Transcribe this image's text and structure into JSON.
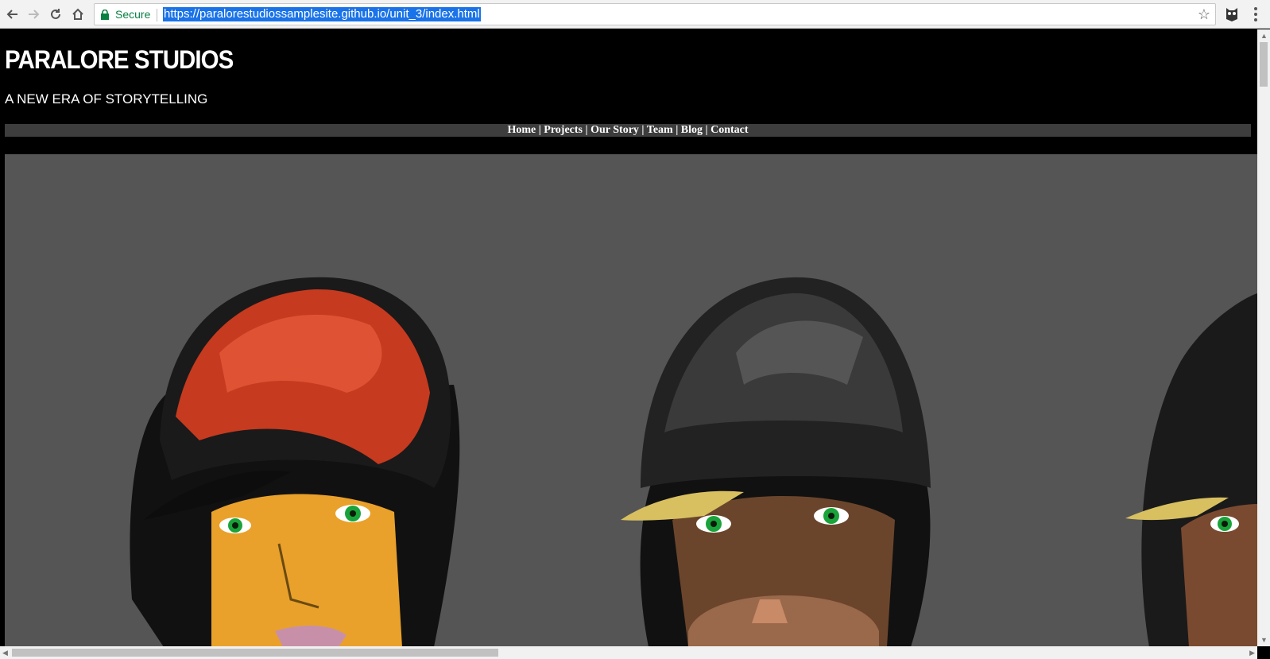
{
  "browser": {
    "secure_label": "Secure",
    "url": "https://paralorestudiossamplesite.github.io/unit_3/index.html"
  },
  "site": {
    "title": "PARALORE STUDIOS",
    "tagline": "A NEW ERA OF STORYTELLING",
    "nav": [
      {
        "label": "Home"
      },
      {
        "label": "Projects"
      },
      {
        "label": "Our Story"
      },
      {
        "label": "Team"
      },
      {
        "label": "Blog"
      },
      {
        "label": "Contact"
      }
    ],
    "nav_separator": " | "
  },
  "colors": {
    "page_bg": "#000000",
    "navbar_bg": "#3d3d3d",
    "hero_bg": "#555555",
    "url_highlight": "#1a73e8"
  }
}
